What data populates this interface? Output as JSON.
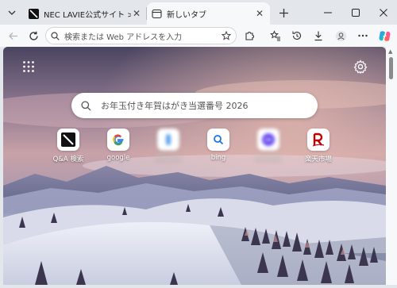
{
  "tabs": [
    {
      "title": "NEC LAVIE公式サイト > サービス",
      "active": false
    },
    {
      "title": "新しいタブ",
      "active": true
    }
  ],
  "toolbar": {
    "address_placeholder": "検索または Web アドレスを入力"
  },
  "newtab": {
    "search_query": "お年玉付き年賀はがき当選番号 2026",
    "quick_links": [
      {
        "label": "Q&A 検索",
        "icon": "nec-square-icon",
        "blurred": false
      },
      {
        "label": "google",
        "icon": "google-icon",
        "blurred": false
      },
      {
        "label": "",
        "icon": "blurred-site-icon",
        "blurred": true
      },
      {
        "label": "bing",
        "icon": "bing-search-icon",
        "blurred": false
      },
      {
        "label": "",
        "icon": "blurred-site-icon",
        "blurred": true
      },
      {
        "label": "楽天市場",
        "icon": "rakuten-icon",
        "blurred": false
      }
    ]
  },
  "colors": {
    "accent": "#0f6cbd",
    "tabstrip": "#e3e6ea",
    "toolbar": "#f7f8fa",
    "rakuten_red": "#bf0000"
  }
}
